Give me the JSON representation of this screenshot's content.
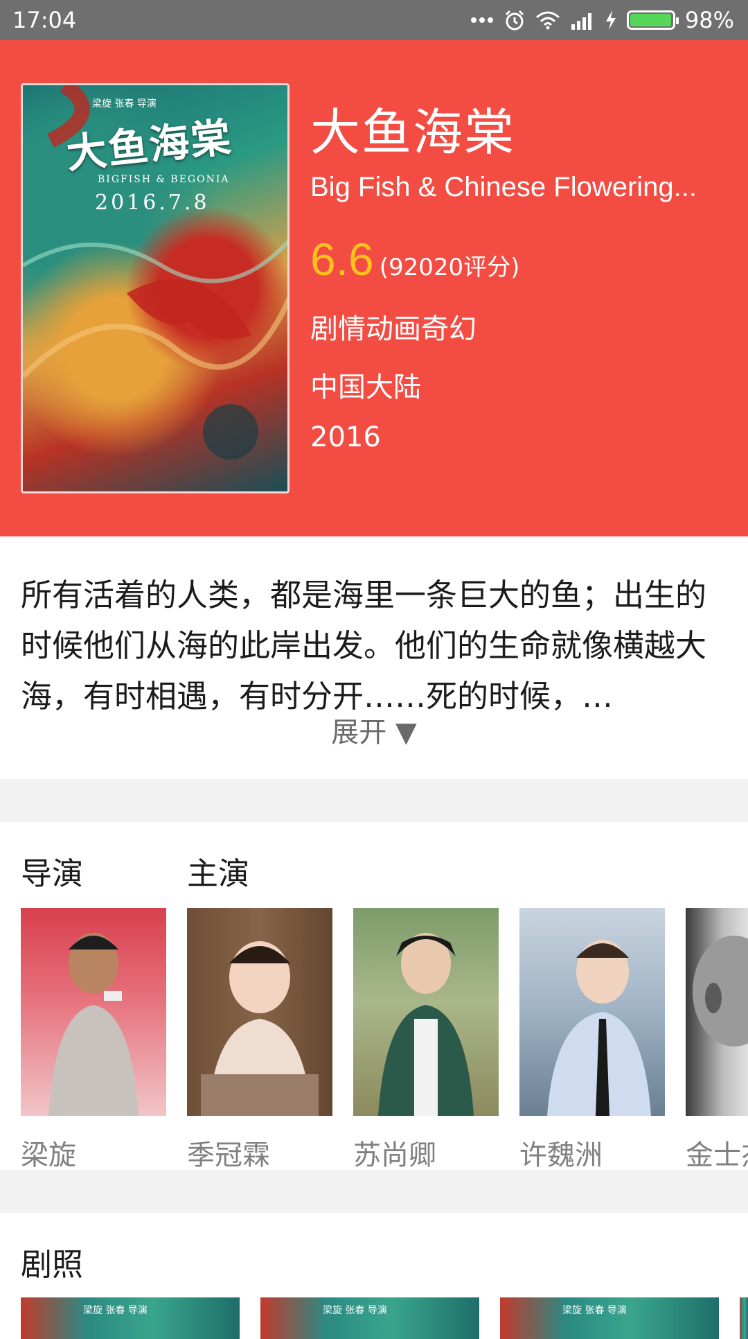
{
  "status_bar": {
    "time": "17:04",
    "battery_percent": "98%",
    "battery_level": 0.98,
    "icons": [
      "dots-icon",
      "alarm-icon",
      "wifi-icon",
      "signal-icon",
      "charging-icon",
      "battery-icon"
    ]
  },
  "movie": {
    "title": "大鱼海棠",
    "english_title": "Big Fish & Chinese Flowering...",
    "rating": "6.6",
    "rating_count": "(92020评分)",
    "genres": "剧情动画奇幻",
    "region": "中国大陆",
    "year": "2016",
    "colors": {
      "header_bg": "#f24c43",
      "rating": "#ffc21c"
    }
  },
  "poster": {
    "title": "大鱼海棠",
    "credit": "梁旋 张春 导演",
    "english": "BIGFISH & BEGONIA",
    "date": "2016.7.8"
  },
  "synopsis": {
    "text": "所有活着的人类，都是海里一条巨大的鱼；出生的时候他们从海的此岸出发。他们的生命就像横越大海，有时相遇，有时分开……死的时候，…",
    "expand_label": "展开 ▼"
  },
  "cast": {
    "director_heading": "导演",
    "actors_heading": "主演",
    "people": [
      {
        "name": "梁旋",
        "role": "director"
      },
      {
        "name": "季冠霖",
        "role": "actor"
      },
      {
        "name": "苏尚卿",
        "role": "actor"
      },
      {
        "name": "许魏洲",
        "role": "actor"
      },
      {
        "name": "金士杰",
        "role": "actor"
      }
    ]
  },
  "stills": {
    "heading": "剧照",
    "caption": "梁旋 张春 导演"
  }
}
